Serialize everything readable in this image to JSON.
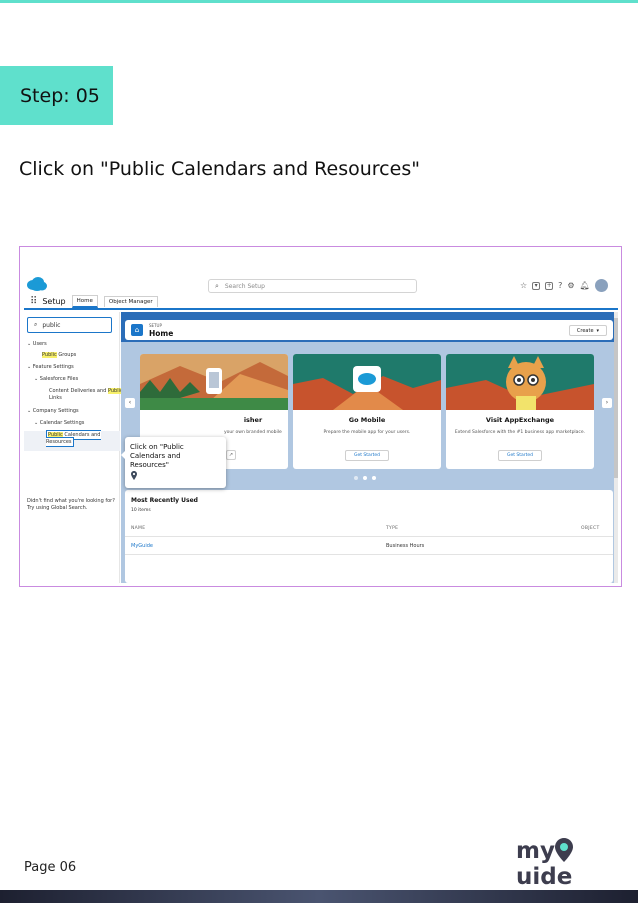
{
  "step": {
    "label": "Step: 05"
  },
  "instruction": "Click on \"Public Calendars and Resources\"",
  "screenshot": {
    "header": {
      "search_placeholder": "Search Setup"
    },
    "nav": {
      "app_title": "Setup",
      "tabs": [
        {
          "label": "Home"
        },
        {
          "label": "Object Manager"
        }
      ]
    },
    "sidebar": {
      "quickfind_value": "public",
      "tree": {
        "users": "Users",
        "public_groups_hl": "Public",
        "public_groups_rest": " Groups",
        "feature_settings": "Feature Settings",
        "salesforce_files": "Salesforce Files",
        "content_deliveries_a": "Content Deliveries and ",
        "content_deliveries_hl": "Public",
        "content_deliveries_b": "Links",
        "company_settings": "Company Settings",
        "calendar_settings": "Calendar Settings",
        "pub_cal_hl": "Public",
        "pub_cal_a": " Calendars and",
        "pub_cal_b": "Resources"
      },
      "no_match_1": "Didn't find what you're looking for?",
      "no_match_2": "Try using Global Search."
    },
    "main": {
      "breadcrumb": "SETUP",
      "title": "Home",
      "create_label": "Create",
      "cards": [
        {
          "title": "isher",
          "desc": "your own branded mobile",
          "button": ""
        },
        {
          "title": "Go Mobile",
          "desc": "Prepare the mobile app for your users.",
          "button": "Get Started"
        },
        {
          "title": "Visit AppExchange",
          "desc": "Extend Salesforce with the #1 business app marketplace.",
          "button": "Get Started"
        }
      ],
      "recent": {
        "title": "Most Recently Used",
        "count": "10 items",
        "columns": [
          "NAME",
          "TYPE",
          "OBJECT"
        ],
        "rows": [
          {
            "name": "MyGuide",
            "type": "Business Hours"
          }
        ]
      }
    },
    "tooltip": "Click on \"Public Calendars and Resources\""
  },
  "footer": {
    "page_label": "Page 06",
    "logo_a": "my",
    "logo_b": "uide"
  },
  "colors": {
    "accent": "#5fe0cc",
    "salesforce_blue": "#1b76c9",
    "frame_border": "#c98be0"
  }
}
